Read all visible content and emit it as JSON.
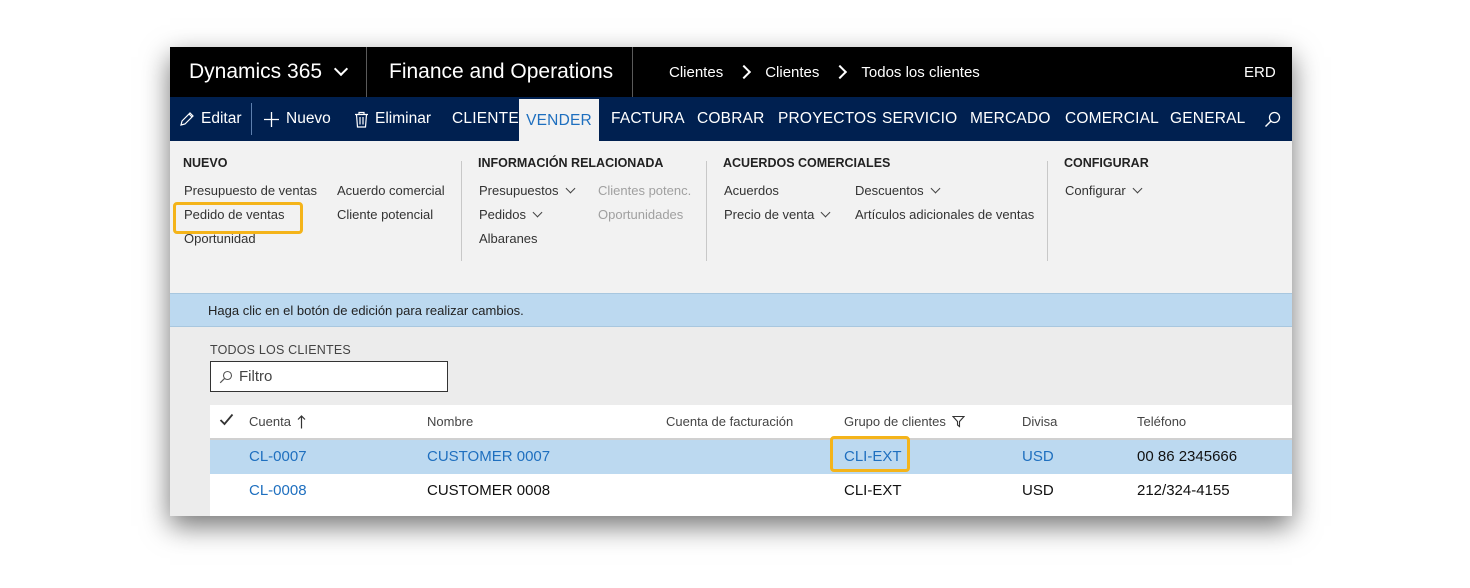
{
  "topbar": {
    "product": "Dynamics 365",
    "module": "Finance and Operations",
    "breadcrumbs": [
      "Clientes",
      "Clientes",
      "Todos los clientes"
    ],
    "company": "ERD"
  },
  "actions": {
    "edit": "Editar",
    "new": "Nuevo",
    "delete": "Eliminar",
    "tabs": [
      "CLIENTE",
      "VENDER",
      "FACTURA",
      "COBRAR",
      "PROYECTOS",
      "SERVICIO",
      "MERCADO",
      "COMERCIAL",
      "GENERAL"
    ],
    "selected_tab": "VENDER"
  },
  "ribbon": {
    "nuevo": {
      "title": "NUEVO",
      "items": [
        "Presupuesto de ventas",
        "Pedido de ventas",
        "Oportunidad",
        "Acuerdo comercial",
        "Cliente potencial"
      ]
    },
    "info": {
      "title": "INFORMACIÓN RELACIONADA",
      "items": [
        "Presupuestos",
        "Pedidos",
        "Albaranes",
        "Clientes potenc.",
        "Oportunidades"
      ]
    },
    "acuerdos": {
      "title": "ACUERDOS COMERCIALES",
      "items": [
        "Acuerdos",
        "Precio de venta",
        "Descuentos",
        "Artículos adicionales de ventas"
      ]
    },
    "configurar": {
      "title": "CONFIGURAR",
      "items": [
        "Configurar"
      ]
    }
  },
  "info_message": "Haga clic en el botón de edición para realizar cambios.",
  "list": {
    "title": "TODOS LOS CLIENTES",
    "filter_placeholder": "Filtro",
    "columns": [
      "Cuenta",
      "Nombre",
      "Cuenta de facturación",
      "Grupo de clientes",
      "Divisa",
      "Teléfono"
    ],
    "rows": [
      {
        "account": "CL-0007",
        "name": "CUSTOMER 0007",
        "billing": "",
        "group": "CLI-EXT",
        "currency": "USD",
        "phone": "00 86 2345666"
      },
      {
        "account": "CL-0008",
        "name": "CUSTOMER 0008",
        "billing": "",
        "group": "CLI-EXT",
        "currency": "USD",
        "phone": "212/324-4155"
      }
    ]
  },
  "colors": {
    "topbar": "#000000",
    "actionbar": "#002050",
    "link": "#1e6fbf",
    "highlight": "#f4b41a",
    "selected_row": "#bcd9f0"
  }
}
